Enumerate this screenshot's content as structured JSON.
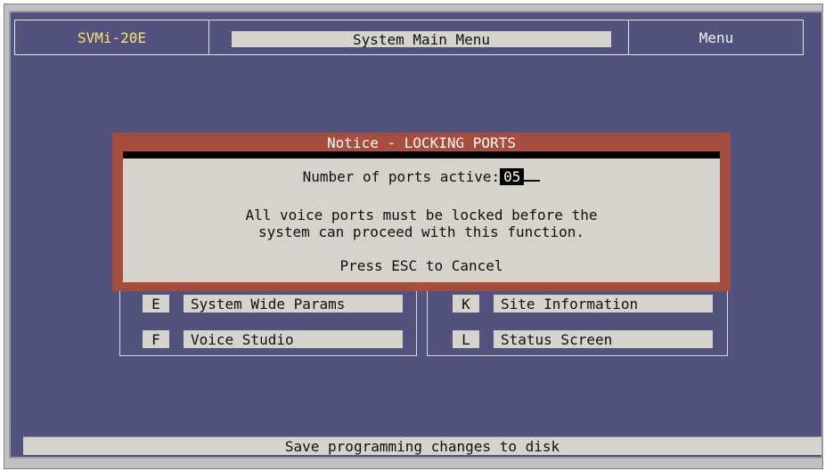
{
  "header": {
    "model": "SVMi-20E",
    "title": "System Main Menu",
    "mode": "Menu"
  },
  "menu_left": [
    {
      "key": "E",
      "label": "System Wide Params"
    },
    {
      "key": "F",
      "label": "Voice Studio"
    }
  ],
  "menu_right": [
    {
      "key": "K",
      "label": "Site Information"
    },
    {
      "key": "L",
      "label": "Status Screen"
    }
  ],
  "dialog": {
    "title": "Notice - LOCKING PORTS",
    "ports_label": "Number of ports active:",
    "ports_value": "05",
    "message_line1": "All voice ports must be locked before the",
    "message_line2": "system can proceed with this function.",
    "cancel_hint": "Press ESC to Cancel"
  },
  "status_bar": {
    "text": "Save programming changes to disk"
  },
  "colors": {
    "background": "#52527e",
    "dialog_border": "#a84e3e",
    "panel": "#d6d2cc",
    "model_text": "#ffe070"
  }
}
